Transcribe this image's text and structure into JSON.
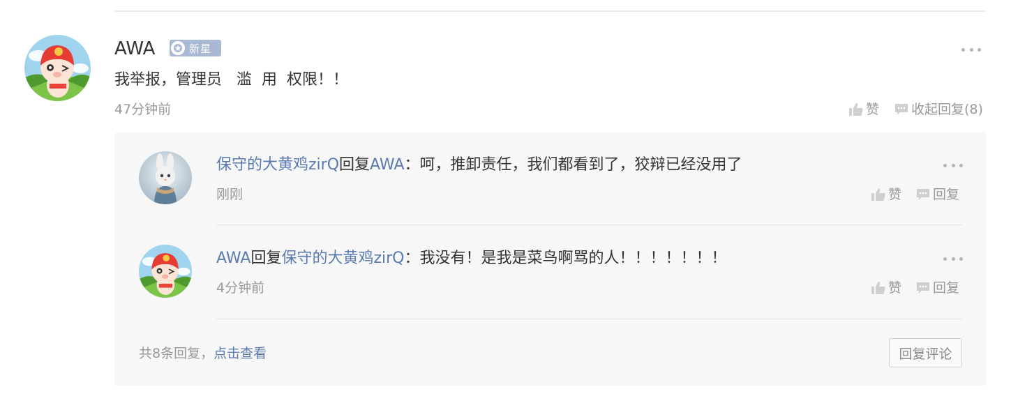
{
  "comment": {
    "author": "AWA",
    "badge": "新星",
    "text": "我举报，管理员   滥  用  权限！！",
    "time": "47分钟前",
    "like_label": "赞",
    "collapse_label": "收起回复(8)",
    "avatar_icon": "cartoon-pig-avatar"
  },
  "replies": [
    {
      "from": "保守的大黄鸡zirQ",
      "reply_word": "回复",
      "to": "AWA",
      "separator": "：",
      "text": "呵，推卸责任，我们都看到了，狡辩已经没用了",
      "time": "刚刚",
      "like_label": "赞",
      "reply_label": "回复",
      "avatar_icon": "bunny-avatar"
    },
    {
      "from": "AWA",
      "reply_word": "回复",
      "to": "保守的大黄鸡zirQ",
      "separator": "：",
      "text": "我没有！是我是菜鸟啊骂的人！！！！！！！",
      "time": "4分钟前",
      "like_label": "赞",
      "reply_label": "回复",
      "avatar_icon": "cartoon-pig-avatar"
    }
  ],
  "summary": {
    "count_text": "共8条回复，",
    "view_link": "点击查看"
  },
  "reply_button": "回复评论",
  "colors": {
    "link": "#5b7bb0",
    "muted": "#999999",
    "badge": "#a9b9d3",
    "reply_bg": "#f7f7f7"
  }
}
